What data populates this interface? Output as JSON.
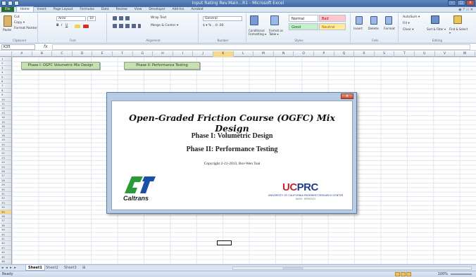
{
  "window": {
    "title": "Input Rating Rev.Main...R1 - Microsoft Excel"
  },
  "ribbon_tabs": [
    "File",
    "Home",
    "Insert",
    "Page Layout",
    "Formulas",
    "Data",
    "Review",
    "View",
    "Developer",
    "Add-Ins",
    "Acrobat"
  ],
  "ribbon": {
    "clipboard": {
      "cut": "Cut",
      "copy": "Copy ▾",
      "paste": "Paste",
      "format_painter": "Format Painter",
      "label": "Clipboard"
    },
    "font": {
      "name": "Arial",
      "size": "10",
      "label": "Font"
    },
    "alignment": {
      "wrap": "Wrap Text",
      "merge": "Merge & Center ▾",
      "label": "Alignment"
    },
    "number": {
      "format": "General",
      "label": "Number"
    },
    "styles": {
      "cf": "Conditional Formatting ▾",
      "table": "Format as Table ▾",
      "normal": "Normal",
      "bad": "Bad",
      "good": "Good",
      "neutral": "Neutral",
      "label": "Styles"
    },
    "cells": {
      "insert": "Insert",
      "delete": "Delete",
      "format": "Format",
      "label": "Cells"
    },
    "editing": {
      "autosum": "AutoSum ▾",
      "fill": "Fill ▾",
      "clear": "Clear ▾",
      "sort": "Sort & Filter ▾",
      "find": "Find & Select ▾",
      "label": "Editing"
    }
  },
  "formula_bar": {
    "name_box": "K35",
    "fx": "fx",
    "formula": ""
  },
  "columns": [
    "A",
    "B",
    "C",
    "D",
    "E",
    "F",
    "G",
    "H",
    "I",
    "J",
    "K",
    "L",
    "M",
    "N",
    "O",
    "P",
    "Q",
    "R",
    "S",
    "T",
    "U",
    "V",
    "W"
  ],
  "selected_column": "K",
  "rows": [
    "1",
    "2",
    "3",
    "4",
    "5",
    "6",
    "7",
    "8",
    "9",
    "10",
    "11",
    "12",
    "13",
    "14",
    "15",
    "16",
    "17",
    "18",
    "19",
    "20",
    "21",
    "22",
    "23",
    "24",
    "25",
    "26",
    "27",
    "28",
    "29",
    "30",
    "31",
    "32",
    "33",
    "34",
    "35",
    "36",
    "37",
    "38",
    "39",
    "40",
    "41",
    "42",
    "43",
    "44",
    "45",
    "46"
  ],
  "selected_row": "35",
  "sheet_buttons": {
    "phase1": "Phase I: OGFC Volumetric Mix Design",
    "phase2": "Phase II: Performance Testing"
  },
  "dialog": {
    "close": "x",
    "title": "Open-Graded Friction Course (OGFC) Mix Design",
    "phase1": "Phase I: Volumetric Design",
    "phase2": "Phase II: Performance Testing",
    "copyright": "Copyright 2-21-2013, Bor-Wen Tsai",
    "caltrans_word": "Caltrans",
    "ucprc_uc": "UC",
    "ucprc_prc": "PRC",
    "ucprc_sub1": "UNIVERSITY OF CALIFORNIA PAVEMENT RESEARCH CENTER",
    "ucprc_sub2": "DAVIS · BERKELEY"
  },
  "sheet_tabs": {
    "nav": "◂ ◂ ▸ ▸",
    "tabs": [
      "Sheet1",
      "Sheet2",
      "Sheet3"
    ],
    "active": "Sheet1"
  },
  "status": {
    "ready": "Ready",
    "zoom": "100%"
  },
  "colors": {
    "title_bar": "#3e69a5",
    "button_fill": "#c6e0b4",
    "dialog_frame": "#b7cbe3",
    "selection": "#f8d88a",
    "ucprc_blue": "#1f3d8c",
    "ucprc_red": "#c2262e"
  }
}
